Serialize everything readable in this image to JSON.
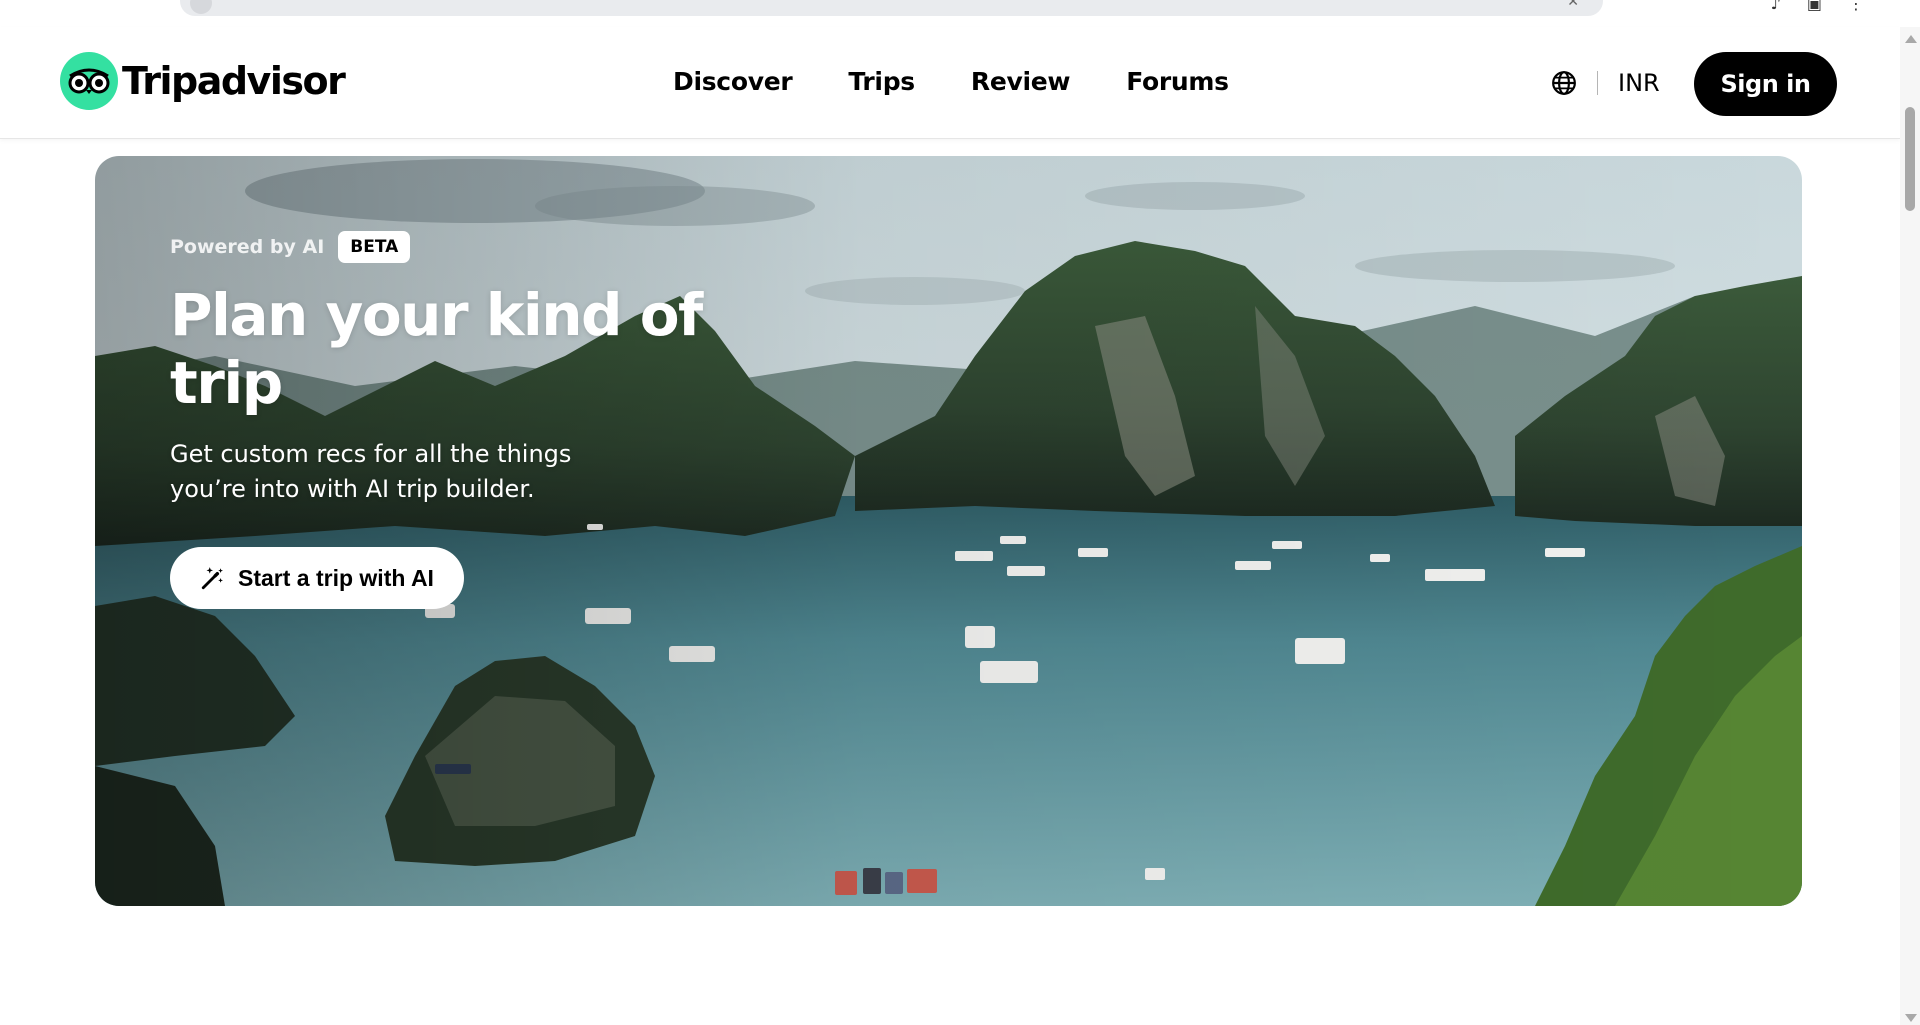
{
  "browser": {
    "address_close_icon": "close-icon"
  },
  "header": {
    "logo_text": "Tripadvisor",
    "logo_icon": "owl-eyes-icon",
    "brand_color": "#34e0a1",
    "nav": [
      {
        "label": "Discover"
      },
      {
        "label": "Trips"
      },
      {
        "label": "Review"
      },
      {
        "label": "Forums"
      }
    ],
    "language_icon": "globe-icon",
    "currency": "INR",
    "sign_in_label": "Sign in"
  },
  "hero": {
    "powered_label": "Powered by AI",
    "badge": "BETA",
    "title": "Plan your kind of trip",
    "subtitle": "Get custom recs for all the things you’re into with AI trip builder.",
    "cta_label": "Start a trip with AI",
    "cta_icon": "magic-wand-icon",
    "image_subject": "bay-with-limestone-karsts-and-boats"
  }
}
